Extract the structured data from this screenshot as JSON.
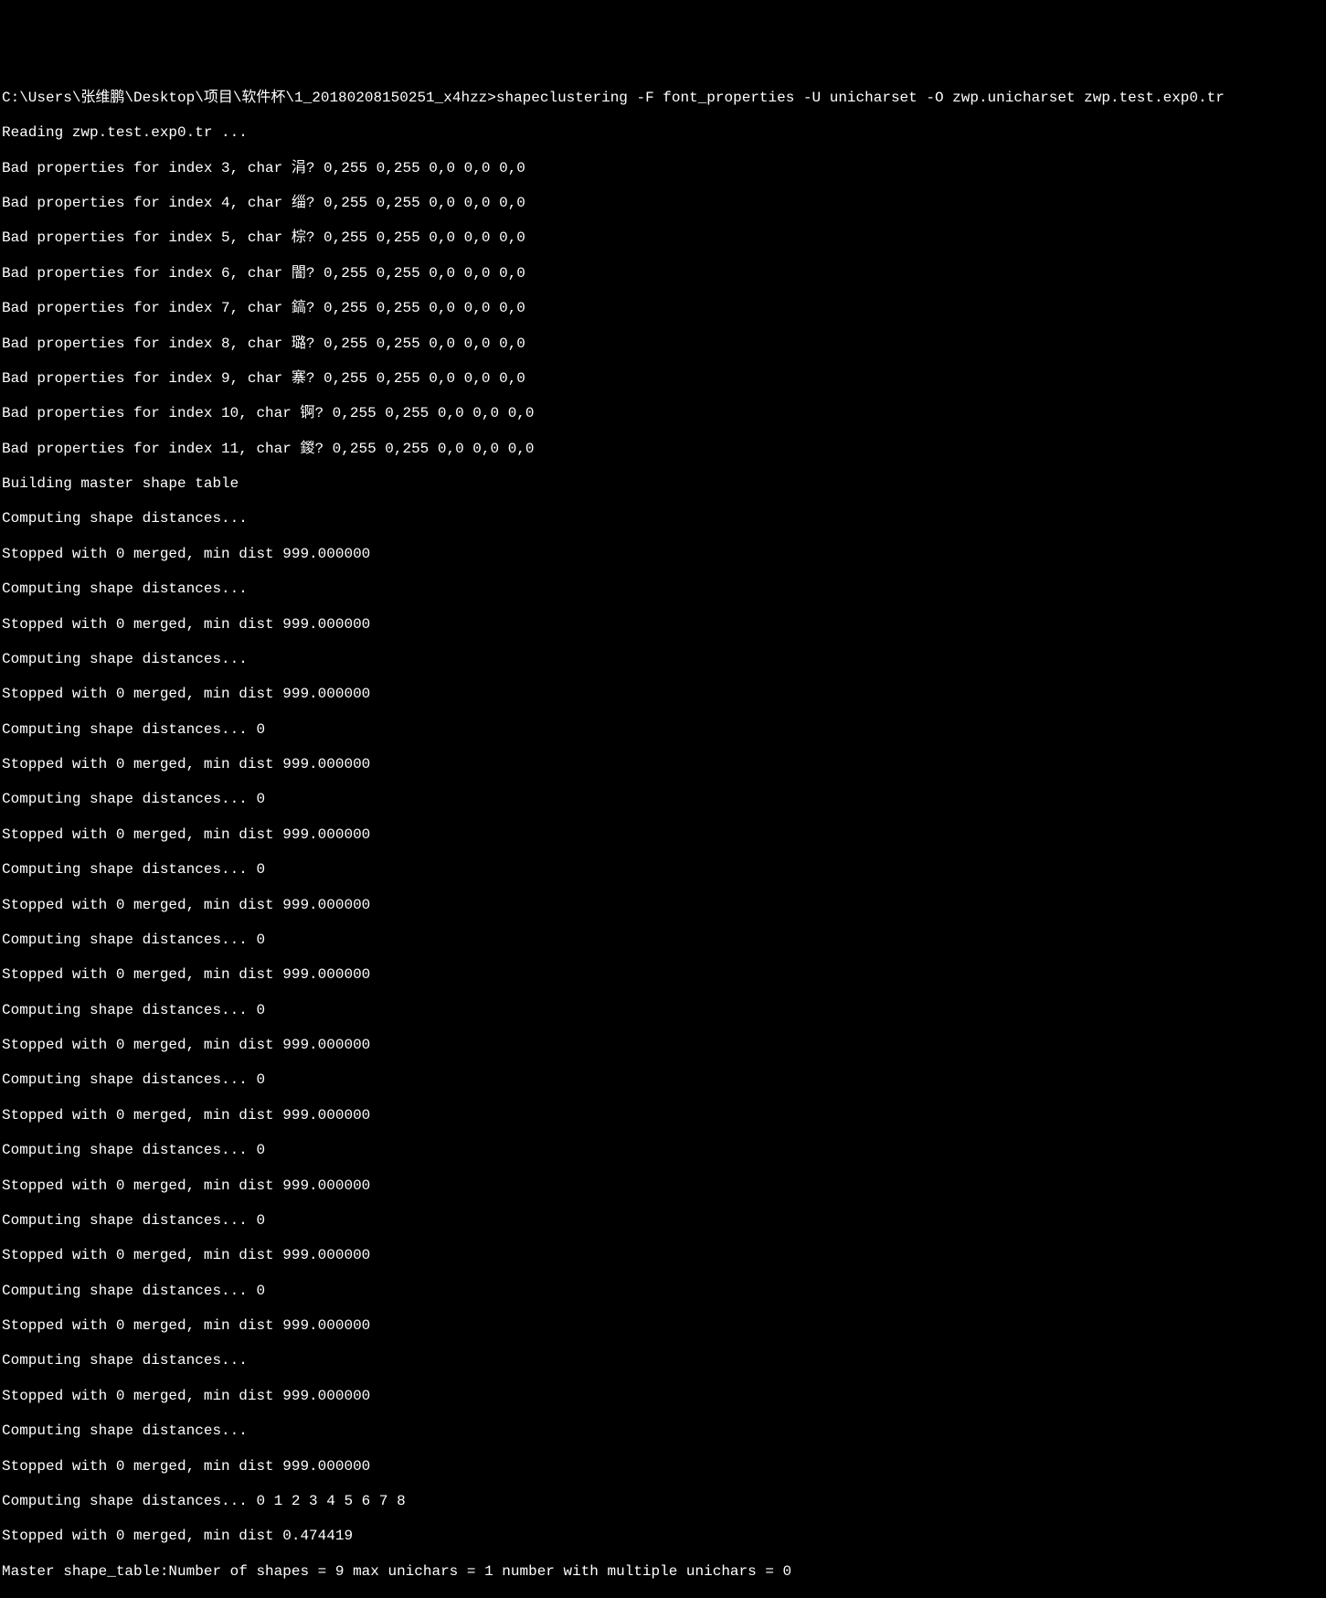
{
  "terminal": {
    "lines": [
      "C:\\Users\\张维鹏\\Desktop\\项目\\软件杯\\1_20180208150251_x4hzz>shapeclustering -F font_properties -U unicharset -O zwp.unicharset zwp.test.exp0.tr",
      "Reading zwp.test.exp0.tr ...",
      "Bad properties for index 3, char 涓? 0,255 0,255 0,0 0,0 0,0",
      "Bad properties for index 4, char 缁? 0,255 0,255 0,0 0,0 0,0",
      "Bad properties for index 5, char 棕? 0,255 0,255 0,0 0,0 0,0",
      "Bad properties for index 6, char 闇? 0,255 0,255 0,0 0,0 0,0",
      "Bad properties for index 7, char 鎬? 0,255 0,255 0,0 0,0 0,0",
      "Bad properties for index 8, char 璐? 0,255 0,255 0,0 0,0 0,0",
      "Bad properties for index 9, char 寨? 0,255 0,255 0,0 0,0 0,0",
      "Bad properties for index 10, char 锕? 0,255 0,255 0,0 0,0 0,0",
      "Bad properties for index 11, char 鍐? 0,255 0,255 0,0 0,0 0,0",
      "Building master shape table",
      "Computing shape distances...",
      "Stopped with 0 merged, min dist 999.000000",
      "Computing shape distances...",
      "Stopped with 0 merged, min dist 999.000000",
      "Computing shape distances...",
      "Stopped with 0 merged, min dist 999.000000",
      "Computing shape distances... 0",
      "Stopped with 0 merged, min dist 999.000000",
      "Computing shape distances... 0",
      "Stopped with 0 merged, min dist 999.000000",
      "Computing shape distances... 0",
      "Stopped with 0 merged, min dist 999.000000",
      "Computing shape distances... 0",
      "Stopped with 0 merged, min dist 999.000000",
      "Computing shape distances... 0",
      "Stopped with 0 merged, min dist 999.000000",
      "Computing shape distances... 0",
      "Stopped with 0 merged, min dist 999.000000",
      "Computing shape distances... 0",
      "Stopped with 0 merged, min dist 999.000000",
      "Computing shape distances... 0",
      "Stopped with 0 merged, min dist 999.000000",
      "Computing shape distances... 0",
      "Stopped with 0 merged, min dist 999.000000",
      "Computing shape distances...",
      "Stopped with 0 merged, min dist 999.000000",
      "Computing shape distances...",
      "Stopped with 0 merged, min dist 999.000000",
      "Computing shape distances... 0 1 2 3 4 5 6 7 8",
      "Stopped with 0 merged, min dist 0.474419",
      "Master shape_table:Number of shapes = 9 max unichars = 1 number with multiple unichars = 0"
    ]
  }
}
